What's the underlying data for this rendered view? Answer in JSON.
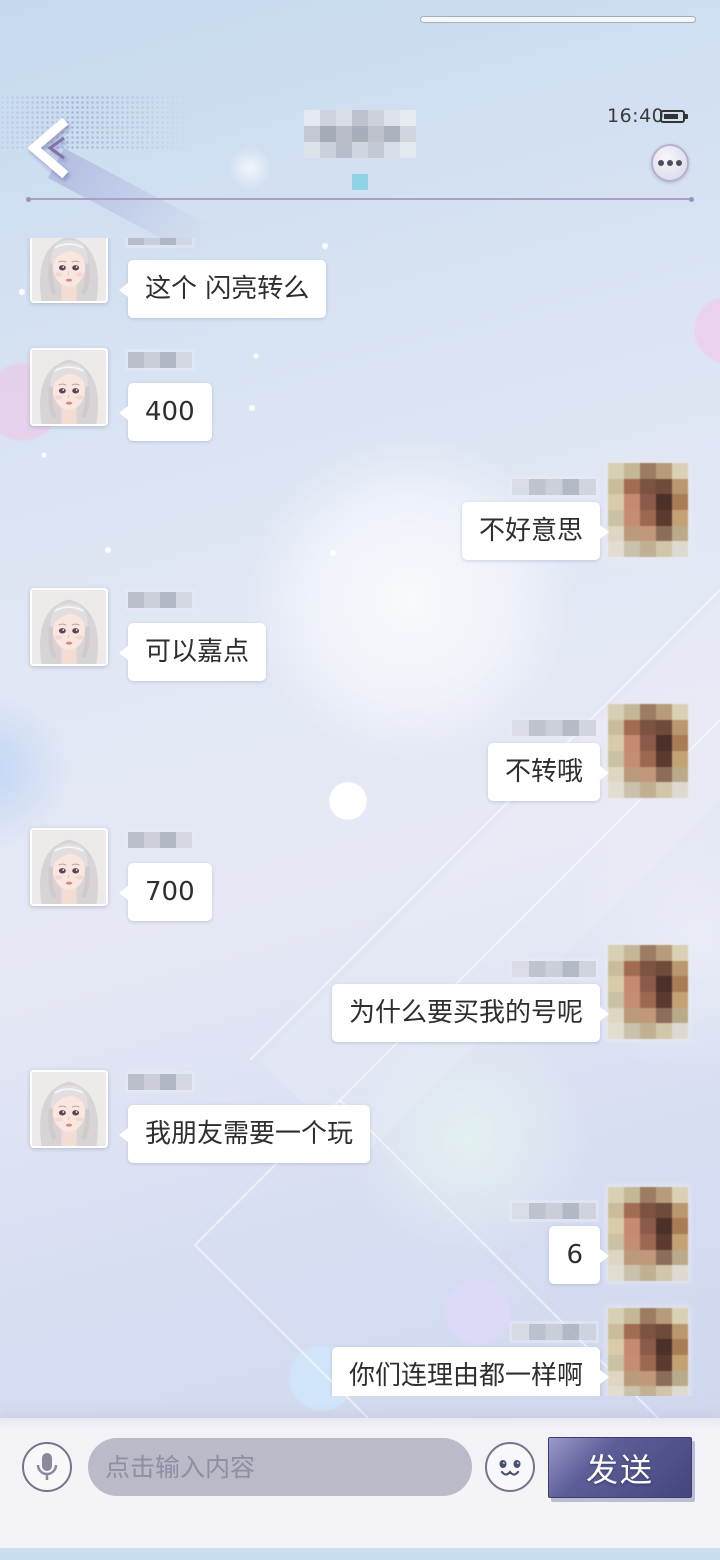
{
  "status_bar": {
    "time": "16:40",
    "battery_level": 0.85
  },
  "messages": [
    {
      "outgoing": false,
      "text": "这个 闪亮转么"
    },
    {
      "outgoing": false,
      "text": "400"
    },
    {
      "outgoing": true,
      "text": "不好意思"
    },
    {
      "outgoing": false,
      "text": "可以嘉点"
    },
    {
      "outgoing": true,
      "text": "不转哦"
    },
    {
      "outgoing": false,
      "text": "700"
    },
    {
      "outgoing": true,
      "text": "为什么要买我的号呢"
    },
    {
      "outgoing": false,
      "text": "我朋友需要一个玩"
    },
    {
      "outgoing": true,
      "text": "6"
    },
    {
      "outgoing": true,
      "text": "你们连理由都一样啊"
    }
  ],
  "input": {
    "placeholder": "点击输入内容"
  },
  "send_button": {
    "label": "发送"
  },
  "icons": {
    "back": "chevron-left-icon",
    "more": "more-dots-icon",
    "battery": "battery-icon",
    "microphone": "microphone-icon",
    "emoji": "emoji-icon"
  },
  "colors": {
    "send_button": "#4a4a84",
    "bubble": "#ffffff",
    "divider": "#aaa0c6",
    "input_field": "#babac9"
  }
}
